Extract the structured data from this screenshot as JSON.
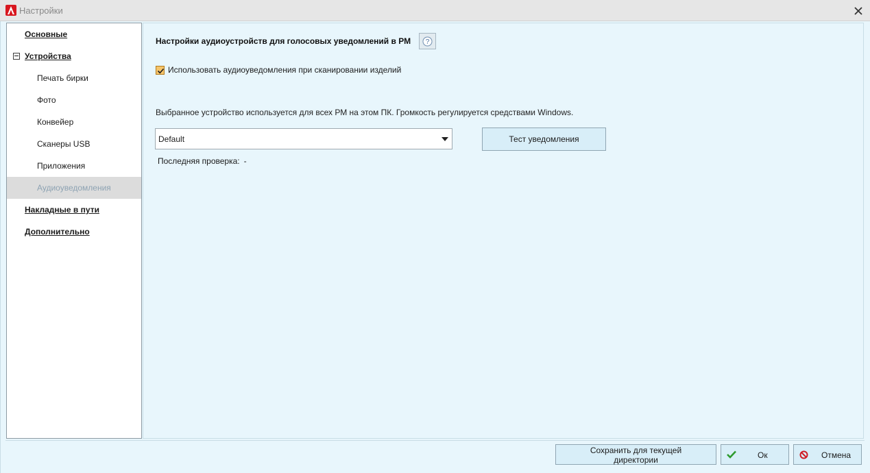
{
  "window": {
    "title": "Настройки",
    "logo_icon": "app-logo-icon",
    "close_icon": "close-icon"
  },
  "sidebar": {
    "items": [
      {
        "label": "Основные",
        "level": "top"
      },
      {
        "label": "Устройства",
        "level": "top",
        "expanded": true
      },
      {
        "label": "Печать бирки",
        "level": "sub"
      },
      {
        "label": "Фото",
        "level": "sub"
      },
      {
        "label": "Конвейер",
        "level": "sub"
      },
      {
        "label": "Сканеры USB",
        "level": "sub"
      },
      {
        "label": "Приложения",
        "level": "sub"
      },
      {
        "label": "Аудиоуведомления",
        "level": "sub",
        "selected": true
      },
      {
        "label": "Накладные в пути",
        "level": "top"
      },
      {
        "label": "Дополнительно",
        "level": "top"
      }
    ]
  },
  "main": {
    "section_title": "Настройки аудиоустройств для голосовых уведомлений в РМ",
    "help_icon": "question-circle-icon",
    "use_audio_checkbox": {
      "label": "Использовать аудиоуведомления при сканировании изделий",
      "checked": true
    },
    "info_text": "Выбранное устройство используется для всех РМ на этом ПК. Громкость регулируется средствами Windows.",
    "device_select": {
      "value": "Default"
    },
    "test_button_label": "Тест уведомления",
    "last_check_label": "Последняя проверка:",
    "last_check_value": "-"
  },
  "footer": {
    "save_label": "Сохранить для текущей директории",
    "ok_label": "Ок",
    "cancel_label": "Отмена"
  },
  "colors": {
    "content_bg": "#e8f6fc",
    "button_bg": "#d8eef8",
    "selected_item_bg": "#dcdcdc",
    "selected_item_text": "#8ea3b3",
    "checkbox_fill": "#f5c46a",
    "ok_icon": "#2e9a2e",
    "cancel_icon": "#d01b24"
  }
}
